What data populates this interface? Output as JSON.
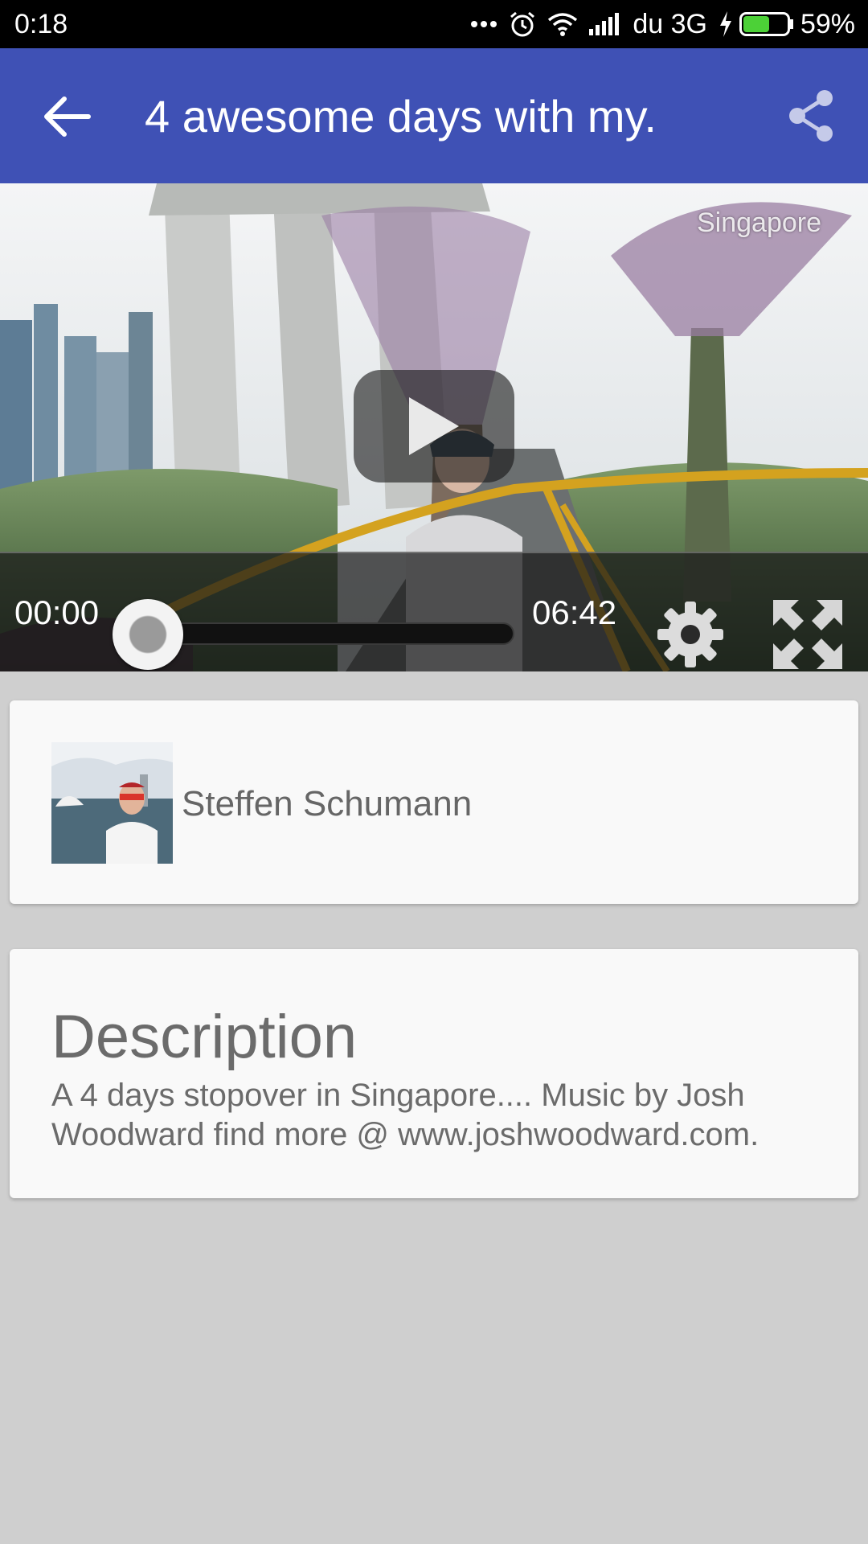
{
  "status_bar": {
    "time": "0:18",
    "carrier": "du 3G",
    "battery_percent_label": "59%",
    "battery_level": 0.59,
    "icons": [
      "more-dots-icon",
      "alarm-icon",
      "wifi-icon",
      "signal-icon",
      "charging-icon",
      "battery-icon"
    ]
  },
  "app_bar": {
    "title": "4 awesome days with my.",
    "color": "#3f51b5",
    "back_icon": "arrow-back-icon",
    "share_icon": "share-icon"
  },
  "video": {
    "watermark": "Singapore",
    "current_time": "00:00",
    "duration": "06:42",
    "progress": 0,
    "icons": [
      "play-icon",
      "settings-gear-icon",
      "fullscreen-icon"
    ]
  },
  "author": {
    "name": "Steffen Schumann"
  },
  "description": {
    "heading": "Description",
    "text": "A 4 days stopover in Singapore.... Music by Josh Woodward find more @ www.joshwoodward.com."
  }
}
